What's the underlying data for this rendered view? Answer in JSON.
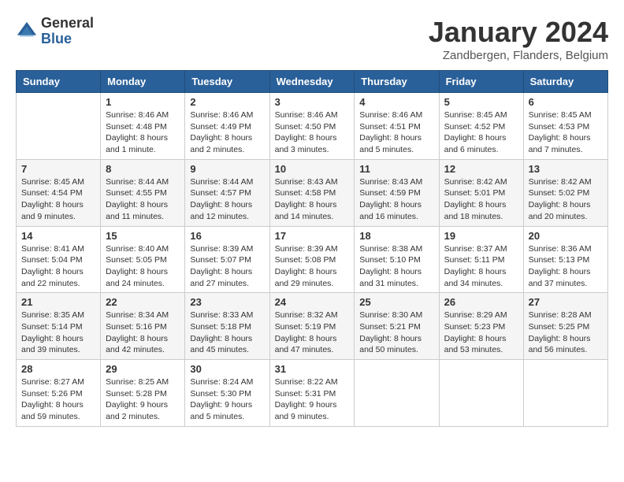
{
  "logo": {
    "general": "General",
    "blue": "Blue"
  },
  "header": {
    "month_year": "January 2024",
    "location": "Zandbergen, Flanders, Belgium"
  },
  "weekdays": [
    "Sunday",
    "Monday",
    "Tuesday",
    "Wednesday",
    "Thursday",
    "Friday",
    "Saturday"
  ],
  "weeks": [
    [
      {
        "day": "",
        "sunrise": "",
        "sunset": "",
        "daylight": ""
      },
      {
        "day": "1",
        "sunrise": "Sunrise: 8:46 AM",
        "sunset": "Sunset: 4:48 PM",
        "daylight": "Daylight: 8 hours and 1 minute."
      },
      {
        "day": "2",
        "sunrise": "Sunrise: 8:46 AM",
        "sunset": "Sunset: 4:49 PM",
        "daylight": "Daylight: 8 hours and 2 minutes."
      },
      {
        "day": "3",
        "sunrise": "Sunrise: 8:46 AM",
        "sunset": "Sunset: 4:50 PM",
        "daylight": "Daylight: 8 hours and 3 minutes."
      },
      {
        "day": "4",
        "sunrise": "Sunrise: 8:46 AM",
        "sunset": "Sunset: 4:51 PM",
        "daylight": "Daylight: 8 hours and 5 minutes."
      },
      {
        "day": "5",
        "sunrise": "Sunrise: 8:45 AM",
        "sunset": "Sunset: 4:52 PM",
        "daylight": "Daylight: 8 hours and 6 minutes."
      },
      {
        "day": "6",
        "sunrise": "Sunrise: 8:45 AM",
        "sunset": "Sunset: 4:53 PM",
        "daylight": "Daylight: 8 hours and 7 minutes."
      }
    ],
    [
      {
        "day": "7",
        "sunrise": "Sunrise: 8:45 AM",
        "sunset": "Sunset: 4:54 PM",
        "daylight": "Daylight: 8 hours and 9 minutes."
      },
      {
        "day": "8",
        "sunrise": "Sunrise: 8:44 AM",
        "sunset": "Sunset: 4:55 PM",
        "daylight": "Daylight: 8 hours and 11 minutes."
      },
      {
        "day": "9",
        "sunrise": "Sunrise: 8:44 AM",
        "sunset": "Sunset: 4:57 PM",
        "daylight": "Daylight: 8 hours and 12 minutes."
      },
      {
        "day": "10",
        "sunrise": "Sunrise: 8:43 AM",
        "sunset": "Sunset: 4:58 PM",
        "daylight": "Daylight: 8 hours and 14 minutes."
      },
      {
        "day": "11",
        "sunrise": "Sunrise: 8:43 AM",
        "sunset": "Sunset: 4:59 PM",
        "daylight": "Daylight: 8 hours and 16 minutes."
      },
      {
        "day": "12",
        "sunrise": "Sunrise: 8:42 AM",
        "sunset": "Sunset: 5:01 PM",
        "daylight": "Daylight: 8 hours and 18 minutes."
      },
      {
        "day": "13",
        "sunrise": "Sunrise: 8:42 AM",
        "sunset": "Sunset: 5:02 PM",
        "daylight": "Daylight: 8 hours and 20 minutes."
      }
    ],
    [
      {
        "day": "14",
        "sunrise": "Sunrise: 8:41 AM",
        "sunset": "Sunset: 5:04 PM",
        "daylight": "Daylight: 8 hours and 22 minutes."
      },
      {
        "day": "15",
        "sunrise": "Sunrise: 8:40 AM",
        "sunset": "Sunset: 5:05 PM",
        "daylight": "Daylight: 8 hours and 24 minutes."
      },
      {
        "day": "16",
        "sunrise": "Sunrise: 8:39 AM",
        "sunset": "Sunset: 5:07 PM",
        "daylight": "Daylight: 8 hours and 27 minutes."
      },
      {
        "day": "17",
        "sunrise": "Sunrise: 8:39 AM",
        "sunset": "Sunset: 5:08 PM",
        "daylight": "Daylight: 8 hours and 29 minutes."
      },
      {
        "day": "18",
        "sunrise": "Sunrise: 8:38 AM",
        "sunset": "Sunset: 5:10 PM",
        "daylight": "Daylight: 8 hours and 31 minutes."
      },
      {
        "day": "19",
        "sunrise": "Sunrise: 8:37 AM",
        "sunset": "Sunset: 5:11 PM",
        "daylight": "Daylight: 8 hours and 34 minutes."
      },
      {
        "day": "20",
        "sunrise": "Sunrise: 8:36 AM",
        "sunset": "Sunset: 5:13 PM",
        "daylight": "Daylight: 8 hours and 37 minutes."
      }
    ],
    [
      {
        "day": "21",
        "sunrise": "Sunrise: 8:35 AM",
        "sunset": "Sunset: 5:14 PM",
        "daylight": "Daylight: 8 hours and 39 minutes."
      },
      {
        "day": "22",
        "sunrise": "Sunrise: 8:34 AM",
        "sunset": "Sunset: 5:16 PM",
        "daylight": "Daylight: 8 hours and 42 minutes."
      },
      {
        "day": "23",
        "sunrise": "Sunrise: 8:33 AM",
        "sunset": "Sunset: 5:18 PM",
        "daylight": "Daylight: 8 hours and 45 minutes."
      },
      {
        "day": "24",
        "sunrise": "Sunrise: 8:32 AM",
        "sunset": "Sunset: 5:19 PM",
        "daylight": "Daylight: 8 hours and 47 minutes."
      },
      {
        "day": "25",
        "sunrise": "Sunrise: 8:30 AM",
        "sunset": "Sunset: 5:21 PM",
        "daylight": "Daylight: 8 hours and 50 minutes."
      },
      {
        "day": "26",
        "sunrise": "Sunrise: 8:29 AM",
        "sunset": "Sunset: 5:23 PM",
        "daylight": "Daylight: 8 hours and 53 minutes."
      },
      {
        "day": "27",
        "sunrise": "Sunrise: 8:28 AM",
        "sunset": "Sunset: 5:25 PM",
        "daylight": "Daylight: 8 hours and 56 minutes."
      }
    ],
    [
      {
        "day": "28",
        "sunrise": "Sunrise: 8:27 AM",
        "sunset": "Sunset: 5:26 PM",
        "daylight": "Daylight: 8 hours and 59 minutes."
      },
      {
        "day": "29",
        "sunrise": "Sunrise: 8:25 AM",
        "sunset": "Sunset: 5:28 PM",
        "daylight": "Daylight: 9 hours and 2 minutes."
      },
      {
        "day": "30",
        "sunrise": "Sunrise: 8:24 AM",
        "sunset": "Sunset: 5:30 PM",
        "daylight": "Daylight: 9 hours and 5 minutes."
      },
      {
        "day": "31",
        "sunrise": "Sunrise: 8:22 AM",
        "sunset": "Sunset: 5:31 PM",
        "daylight": "Daylight: 9 hours and 9 minutes."
      },
      {
        "day": "",
        "sunrise": "",
        "sunset": "",
        "daylight": ""
      },
      {
        "day": "",
        "sunrise": "",
        "sunset": "",
        "daylight": ""
      },
      {
        "day": "",
        "sunrise": "",
        "sunset": "",
        "daylight": ""
      }
    ]
  ]
}
